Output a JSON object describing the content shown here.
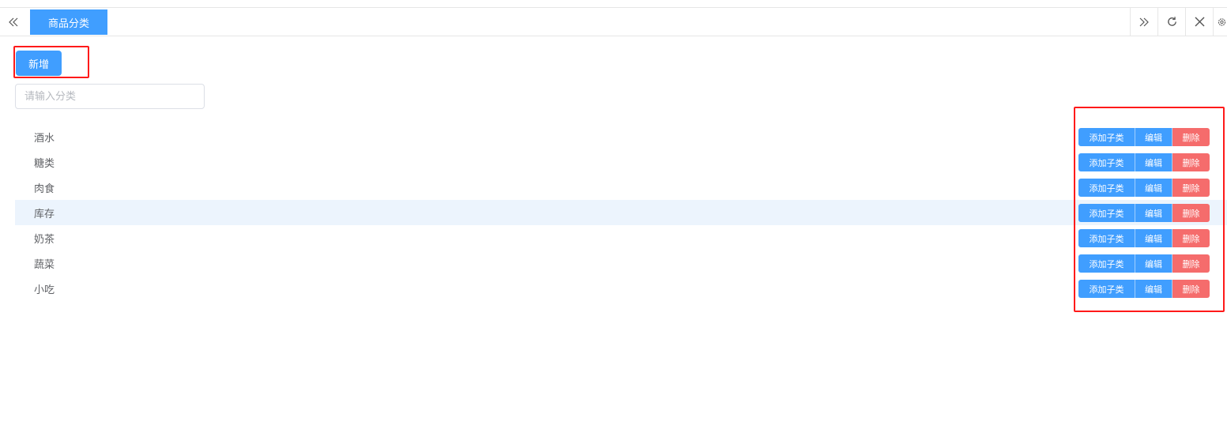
{
  "tabbar": {
    "active_tab": "商品分类",
    "scroll_left_icon": "double-chevron-left",
    "tools": [
      "double-chevron-right",
      "refresh",
      "close",
      "settings"
    ]
  },
  "toolbar": {
    "add_label": "新增"
  },
  "search": {
    "placeholder": "请输入分类",
    "value": ""
  },
  "categories": [
    {
      "label": "酒水"
    },
    {
      "label": "糖类"
    },
    {
      "label": "肉食"
    },
    {
      "label": "库存"
    },
    {
      "label": "奶茶"
    },
    {
      "label": "蔬菜"
    },
    {
      "label": "小吃"
    }
  ],
  "row_actions": {
    "add_child": "添加子类",
    "edit": "编辑",
    "delete": "删除"
  },
  "colors": {
    "primary": "#409eff",
    "danger": "#f56c6c",
    "highlight_border": "#ff1a1a",
    "row_hover": "#ecf4fd"
  }
}
